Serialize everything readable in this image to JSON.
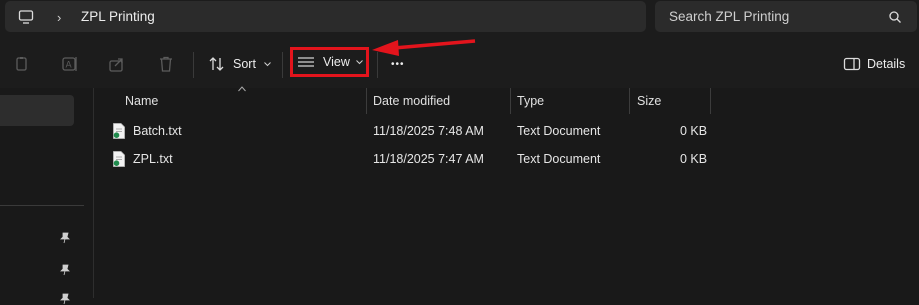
{
  "address": {
    "breadcrumb": "ZPL Printing",
    "separator": "›"
  },
  "search": {
    "placeholder": "Search ZPL Printing"
  },
  "toolbar": {
    "sort_label": "Sort",
    "view_label": "View",
    "more_label": "•••",
    "details_label": "Details"
  },
  "columns": {
    "name": "Name",
    "date": "Date modified",
    "type": "Type",
    "size": "Size"
  },
  "files": [
    {
      "name": "Batch.txt",
      "date": "11/18/2025 7:48 AM",
      "type": "Text Document",
      "size": "0 KB"
    },
    {
      "name": "ZPL.txt",
      "date": "11/18/2025 7:47 AM",
      "type": "Text Document",
      "size": "0 KB"
    }
  ],
  "colors": {
    "accent_highlight": "#e3141c",
    "background": "#191919"
  },
  "icons": [
    "this-pc-icon",
    "search-icon",
    "copy-icon",
    "rename-icon",
    "share-icon",
    "delete-icon",
    "sort-icon",
    "view-list-icon",
    "chevron-down-icon",
    "details-pane-icon",
    "pin-icon",
    "text-file-icon"
  ]
}
